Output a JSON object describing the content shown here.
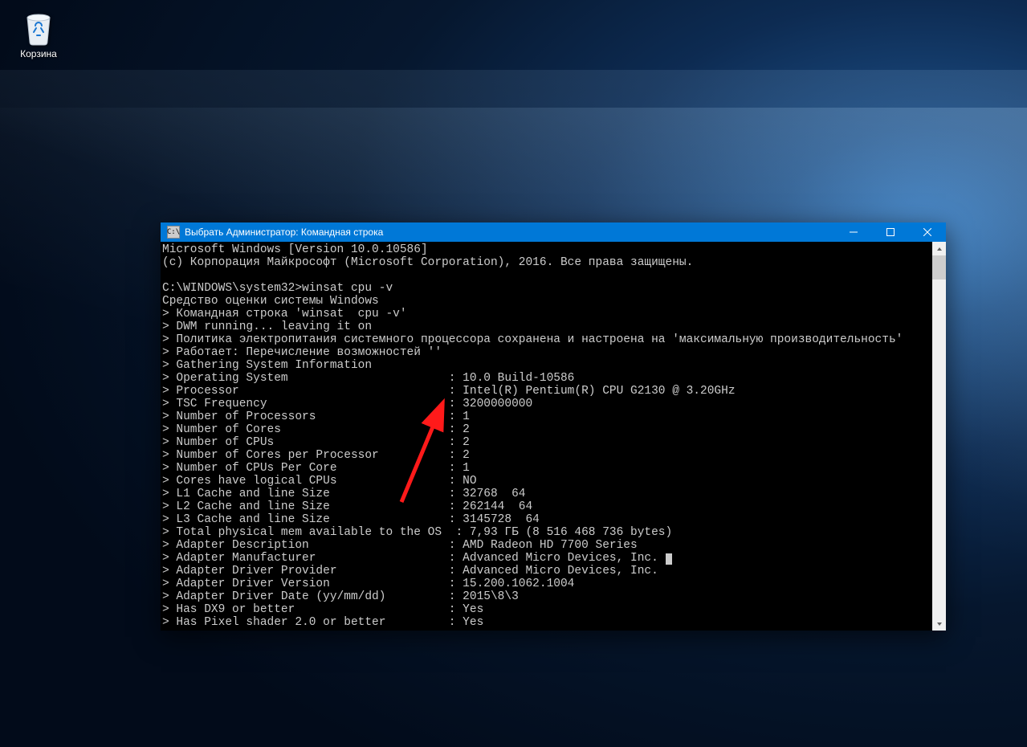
{
  "desktop": {
    "recycle_bin_label": "Корзина"
  },
  "window": {
    "title": "Выбрать Администратор: Командная строка",
    "sys_icon_text": "C:\\"
  },
  "console": {
    "lines": [
      "Microsoft Windows [Version 10.0.10586]",
      "(c) Корпорация Майкрософт (Microsoft Corporation), 2016. Все права защищены.",
      "",
      "C:\\WINDOWS\\system32>winsat cpu -v",
      "Средство оценки системы Windows",
      "> Командная строка 'winsat  cpu -v'",
      "> DWM running... leaving it on",
      "> Политика электропитания системного процессора сохранена и настроена на 'максимальную производительность'",
      "> Работает: Перечисление возможностей ''",
      "> Gathering System Information",
      "> Operating System                       : 10.0 Build-10586",
      "> Processor                              : Intel(R) Pentium(R) CPU G2130 @ 3.20GHz",
      "> TSC Frequency                          : 3200000000",
      "> Number of Processors                   : 1",
      "> Number of Cores                        : 2",
      "> Number of CPUs                         : 2",
      "> Number of Cores per Processor          : 2",
      "> Number of CPUs Per Core                : 1",
      "> Cores have logical CPUs                : NO",
      "> L1 Cache and line Size                 : 32768  64",
      "> L2 Cache and line Size                 : 262144  64",
      "> L3 Cache and line Size                 : 3145728  64",
      "> Total physical mem available to the OS  : 7,93 ГБ (8 516 468 736 bytes)",
      "> Adapter Description                    : AMD Radeon HD 7700 Series",
      "> Adapter Manufacturer                   : Advanced Micro Devices, Inc. ",
      "> Adapter Driver Provider                : Advanced Micro Devices, Inc.",
      "> Adapter Driver Version                 : 15.200.1062.1004",
      "> Adapter Driver Date (yy/mm/dd)         : 2015\\8\\3",
      "> Has DX9 or better                      : Yes",
      "> Has Pixel shader 2.0 or better         : Yes"
    ],
    "cursor_after_line_index": 24
  },
  "colors": {
    "titlebar": "#0078d7",
    "arrow": "#ff1a1a"
  }
}
